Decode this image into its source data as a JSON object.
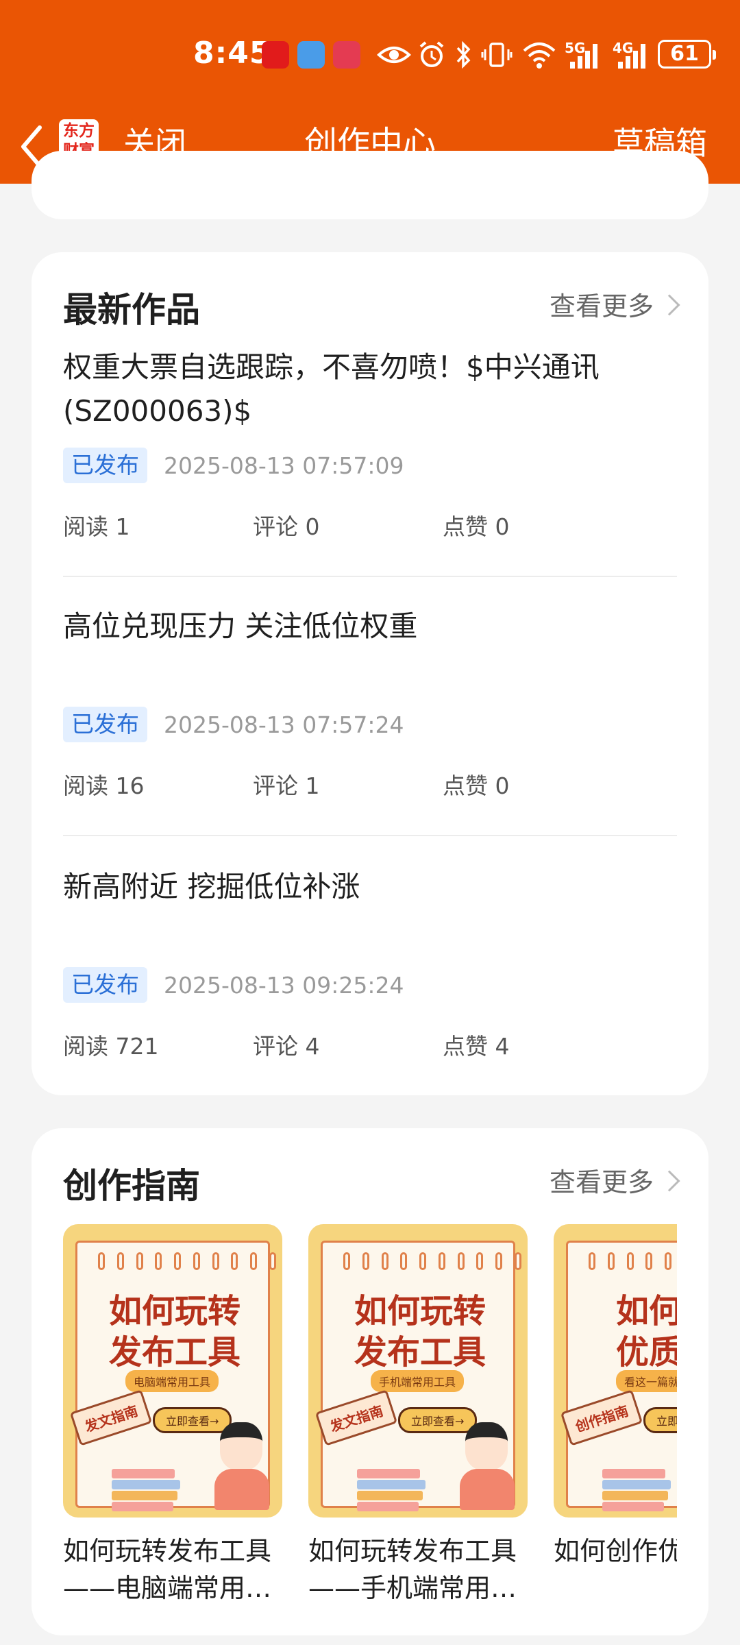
{
  "status_bar": {
    "time": "8:45",
    "battery": "61",
    "network_1": "5G",
    "network_2": "4G"
  },
  "header": {
    "logo_line1": "东方",
    "logo_line2": "财富",
    "close_label": "关闭",
    "title": "创作中心",
    "drafts_label": "草稿箱"
  },
  "latest": {
    "title": "最新作品",
    "more_label": "查看更多",
    "items": [
      {
        "title": "权重大票自选跟踪，不喜勿喷！$中兴通讯(SZ000063)$",
        "status": "已发布",
        "time": "2025-08-13 07:57:09",
        "reads": "阅读 1",
        "comments": "评论 0",
        "likes": "点赞 0"
      },
      {
        "title": "高位兑现压力 关注低位权重",
        "status": "已发布",
        "time": "2025-08-13 07:57:24",
        "reads": "阅读 16",
        "comments": "评论 1",
        "likes": "点赞 0"
      },
      {
        "title": "新高附近 挖掘低位补涨",
        "status": "已发布",
        "time": "2025-08-13 09:25:24",
        "reads": "阅读 721",
        "comments": "评论 4",
        "likes": "点赞 4"
      }
    ]
  },
  "guide": {
    "title": "创作指南",
    "more_label": "查看更多",
    "items": [
      {
        "thumb_line1": "如何玩转",
        "thumb_line2": "发布工具",
        "thumb_tag": "电脑端常用工具",
        "thumb_sign": "发文指南",
        "thumb_button": "立即查看→",
        "label_line1": "如何玩转发布工具",
        "label_line2": "——电脑端常用…"
      },
      {
        "thumb_line1": "如何玩转",
        "thumb_line2": "发布工具",
        "thumb_tag": "手机端常用工具",
        "thumb_sign": "发文指南",
        "thumb_button": "立即查看→",
        "label_line1": "如何玩转发布工具",
        "label_line2": "——手机端常用…"
      },
      {
        "thumb_line1": "如何创",
        "thumb_line2": "优质内",
        "thumb_tag": "看这一篇就",
        "thumb_sign": "创作指南",
        "thumb_button": "立即查看→",
        "label_line1": "如何创作优",
        "label_line2": ""
      }
    ]
  },
  "colors": {
    "brand": "#ea5504",
    "badge_bg": "#e3efff",
    "badge_text": "#2a6fd6"
  }
}
